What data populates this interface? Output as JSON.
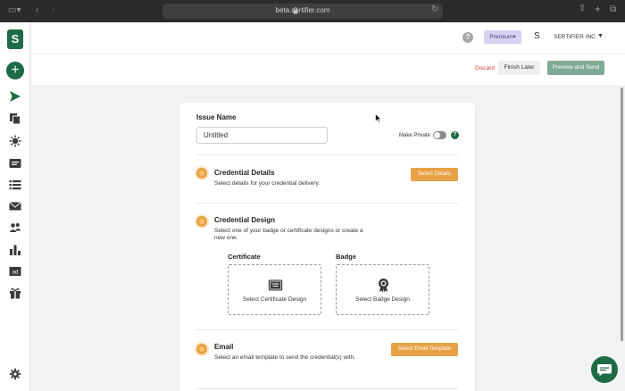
{
  "browser": {
    "url": "beta.sertifier.com"
  },
  "sidebar": {
    "logo_icon": "sertifier-logo",
    "logo_text": "S",
    "add_label": "+",
    "items": [
      {
        "icon": "send-icon"
      },
      {
        "icon": "copy-icon"
      },
      {
        "icon": "integration-icon"
      },
      {
        "icon": "credential-icon"
      },
      {
        "icon": "list-icon"
      },
      {
        "icon": "mail-icon"
      },
      {
        "icon": "users-icon"
      },
      {
        "icon": "analytics-icon"
      },
      {
        "icon": "ad-icon"
      },
      {
        "icon": "gift-icon"
      }
    ],
    "settings_icon": "gear-icon"
  },
  "header": {
    "help": "?",
    "plan": "Premium",
    "avatar": "S",
    "org": "SERTIFIER INC."
  },
  "actions": {
    "discard": "Discard",
    "finish_later": "Finish Later",
    "preview_send": "Preview and Send"
  },
  "issue": {
    "title": "Issue Name",
    "value": "Untitled",
    "make_private": "Make Private",
    "private_enabled": false,
    "info": "?"
  },
  "steps": {
    "details": {
      "title": "Credential Details",
      "desc": "Select details for your credential delivery.",
      "button": "Select Details"
    },
    "design": {
      "title": "Credential Design",
      "desc_line1": "Select one of your badge or certificate designs or create a",
      "desc_line2": "new one.",
      "certificate_head": "Certificate",
      "certificate_label": "Select Certificate Design",
      "badge_head": "Badge",
      "badge_label": "Select Badge Design"
    },
    "email": {
      "title": "Email",
      "desc": "Select an email template to send the credential(s) with.",
      "button": "Select Email Template"
    }
  },
  "colors": {
    "brand": "#1e6b45",
    "accent": "#e8a245",
    "primary_button": "#7faa95",
    "discard": "#c0472d",
    "plan_pill": "#d7d2f2"
  }
}
